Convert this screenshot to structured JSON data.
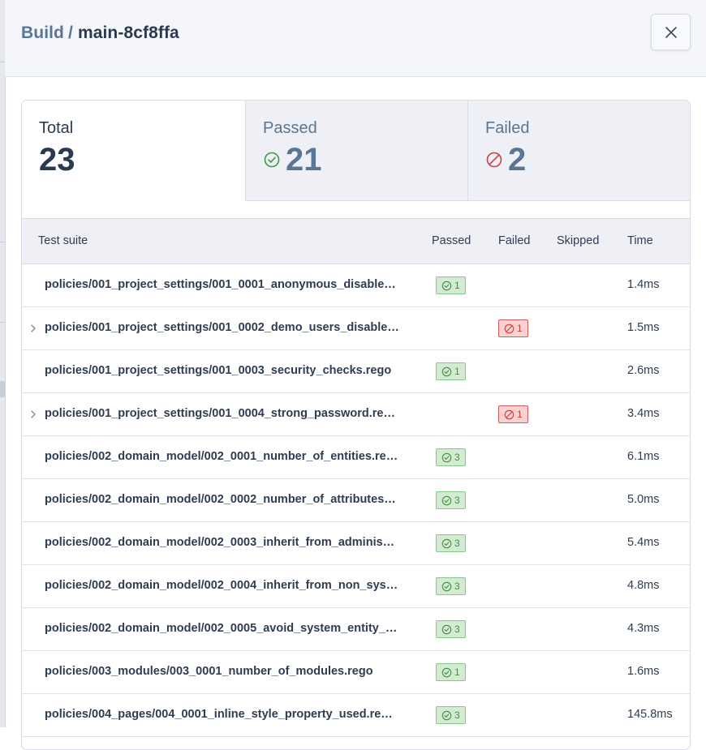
{
  "header": {
    "breadcrumb_root": "Build",
    "breadcrumb_sep": "/",
    "build_name": "main-8cf8ffa"
  },
  "summary": {
    "total": {
      "label": "Total",
      "value": "23"
    },
    "passed": {
      "label": "Passed",
      "value": "21"
    },
    "failed": {
      "label": "Failed",
      "value": "2"
    }
  },
  "table": {
    "headers": {
      "suite": "Test suite",
      "passed": "Passed",
      "failed": "Failed",
      "skipped": "Skipped",
      "time": "Time"
    },
    "rows": [
      {
        "suite": "policies/001_project_settings/001_0001_anonymous_disable…",
        "passed": "1",
        "failed": "",
        "skipped": "",
        "time": "1.4ms",
        "expandable": false
      },
      {
        "suite": "policies/001_project_settings/001_0002_demo_users_disable…",
        "passed": "",
        "failed": "1",
        "skipped": "",
        "time": "1.5ms",
        "expandable": true
      },
      {
        "suite": "policies/001_project_settings/001_0003_security_checks.rego",
        "passed": "1",
        "failed": "",
        "skipped": "",
        "time": "2.6ms",
        "expandable": false
      },
      {
        "suite": "policies/001_project_settings/001_0004_strong_password.re…",
        "passed": "",
        "failed": "1",
        "skipped": "",
        "time": "3.4ms",
        "expandable": true
      },
      {
        "suite": "policies/002_domain_model/002_0001_number_of_entities.re…",
        "passed": "3",
        "failed": "",
        "skipped": "",
        "time": "6.1ms",
        "expandable": false
      },
      {
        "suite": "policies/002_domain_model/002_0002_number_of_attributes…",
        "passed": "3",
        "failed": "",
        "skipped": "",
        "time": "5.0ms",
        "expandable": false
      },
      {
        "suite": "policies/002_domain_model/002_0003_inherit_from_adminis…",
        "passed": "3",
        "failed": "",
        "skipped": "",
        "time": "5.4ms",
        "expandable": false
      },
      {
        "suite": "policies/002_domain_model/002_0004_inherit_from_non_sys…",
        "passed": "3",
        "failed": "",
        "skipped": "",
        "time": "4.8ms",
        "expandable": false
      },
      {
        "suite": "policies/002_domain_model/002_0005_avoid_system_entity_…",
        "passed": "3",
        "failed": "",
        "skipped": "",
        "time": "4.3ms",
        "expandable": false
      },
      {
        "suite": "policies/003_modules/003_0001_number_of_modules.rego",
        "passed": "1",
        "failed": "",
        "skipped": "",
        "time": "1.6ms",
        "expandable": false
      },
      {
        "suite": "policies/004_pages/004_0001_inline_style_property_used.re…",
        "passed": "3",
        "failed": "",
        "skipped": "",
        "time": "145.8ms",
        "expandable": false
      }
    ]
  },
  "colors": {
    "pass_bg": "#d3ecd1",
    "pass_border": "#88c98b",
    "pass_text": "#3f8f45",
    "fail_bg": "#f6d2d2",
    "fail_border": "#d4595b",
    "fail_text": "#c8403f",
    "accent_text": "#5a7694"
  },
  "icons": {
    "close": "close-icon",
    "passed": "check-circle-icon",
    "failed": "ban-circle-icon",
    "expand": "chevron-right-icon"
  }
}
